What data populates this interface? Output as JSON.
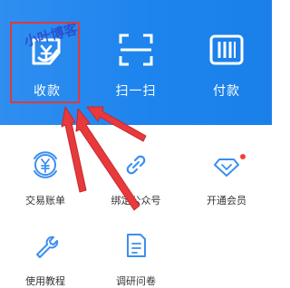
{
  "header": {
    "actions": [
      {
        "label": "收款",
        "icon": "receive-money-icon"
      },
      {
        "label": "扫一扫",
        "icon": "scan-icon"
      },
      {
        "label": "付款",
        "icon": "barcode-pay-icon"
      }
    ]
  },
  "watermark": "小叶博客",
  "grid": {
    "items": [
      {
        "label": "交易账单",
        "icon": "yen-bill-icon"
      },
      {
        "label": "绑定公众号",
        "icon": "link-icon"
      },
      {
        "label": "开通会员",
        "icon": "diamond-icon",
        "badge": true
      },
      {
        "label": "使用教程",
        "icon": "wrench-icon"
      },
      {
        "label": "调研问卷",
        "icon": "questionnaire-icon"
      }
    ]
  },
  "colors": {
    "header_blue": "#1d84ee",
    "icon_blue": "#3a8ff0",
    "annotation_red": "#e0393b",
    "badge_red": "#f04134"
  }
}
